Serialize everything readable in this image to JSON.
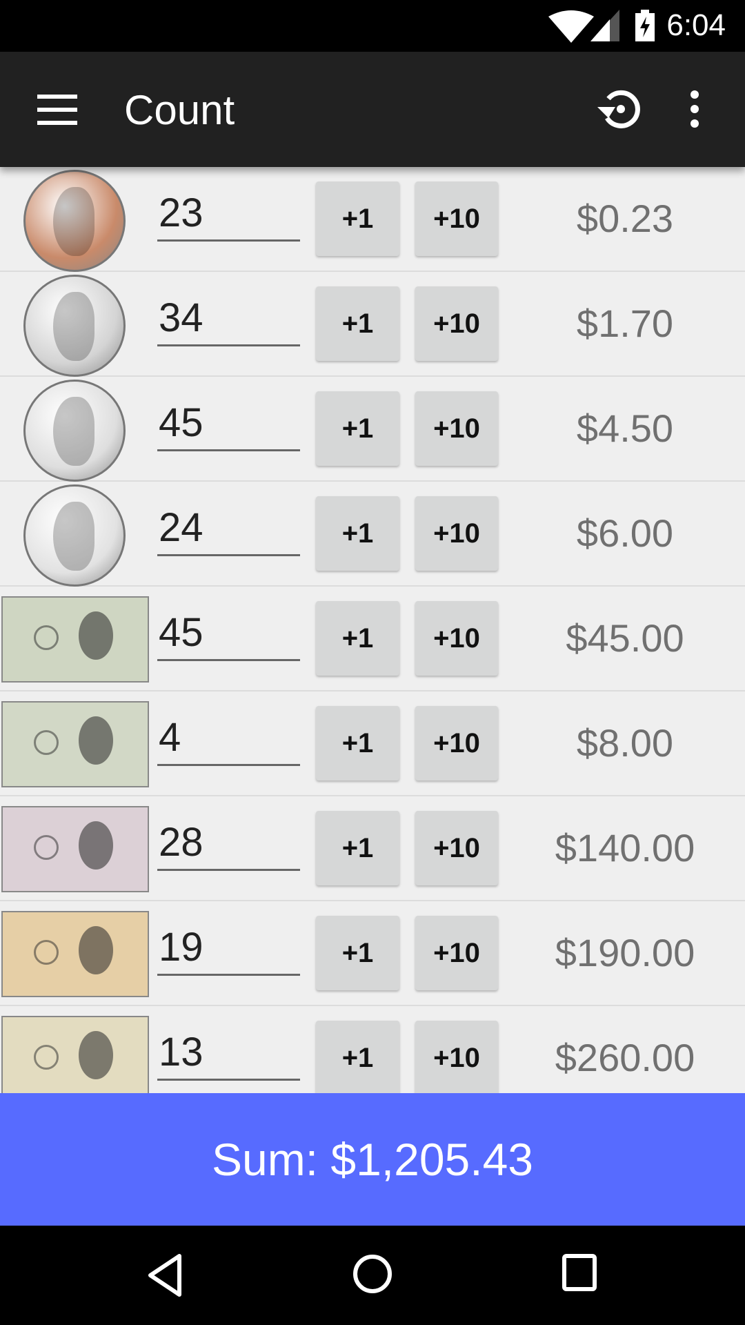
{
  "status_bar": {
    "time": "6:04",
    "icons": [
      "wifi-icon",
      "cell-signal-icon",
      "battery-charging-icon"
    ]
  },
  "app_bar": {
    "title": "Count",
    "icons": [
      "menu-icon",
      "reset-icon",
      "more-vert-icon"
    ]
  },
  "rows": [
    {
      "item": "penny",
      "kind": "coin",
      "color": "#c98a6a",
      "count": "23",
      "plus1": "+1",
      "plus10": "+10",
      "value": "$0.23"
    },
    {
      "item": "nickel",
      "kind": "coin",
      "color": "#d4d4d4",
      "count": "34",
      "plus1": "+1",
      "plus10": "+10",
      "value": "$1.70"
    },
    {
      "item": "dime",
      "kind": "coin",
      "color": "#dedede",
      "count": "45",
      "plus1": "+1",
      "plus10": "+10",
      "value": "$4.50"
    },
    {
      "item": "quarter",
      "kind": "coin",
      "color": "#e2e2e2",
      "count": "24",
      "plus1": "+1",
      "plus10": "+10",
      "value": "$6.00"
    },
    {
      "item": "one-dollar-bill",
      "kind": "bill",
      "color": "#cfd6c2",
      "count": "45",
      "plus1": "+1",
      "plus10": "+10",
      "value": "$45.00"
    },
    {
      "item": "two-dollar-bill",
      "kind": "bill",
      "color": "#d2d8c6",
      "count": "4",
      "plus1": "+1",
      "plus10": "+10",
      "value": "$8.00"
    },
    {
      "item": "five-dollar-bill",
      "kind": "bill",
      "color": "#dcd0d6",
      "count": "28",
      "plus1": "+1",
      "plus10": "+10",
      "value": "$140.00"
    },
    {
      "item": "ten-dollar-bill",
      "kind": "bill",
      "color": "#e6cfa6",
      "count": "19",
      "plus1": "+1",
      "plus10": "+10",
      "value": "$190.00"
    },
    {
      "item": "twenty-dollar-bill",
      "kind": "bill",
      "color": "#e3dcc0",
      "count": "13",
      "plus1": "+1",
      "plus10": "+10",
      "value": "$260.00"
    }
  ],
  "sum": {
    "label": "Sum: $1,205.43",
    "color": "#576bff"
  },
  "nav_bar": {
    "icons": [
      "back-icon",
      "home-icon",
      "recents-icon"
    ]
  }
}
